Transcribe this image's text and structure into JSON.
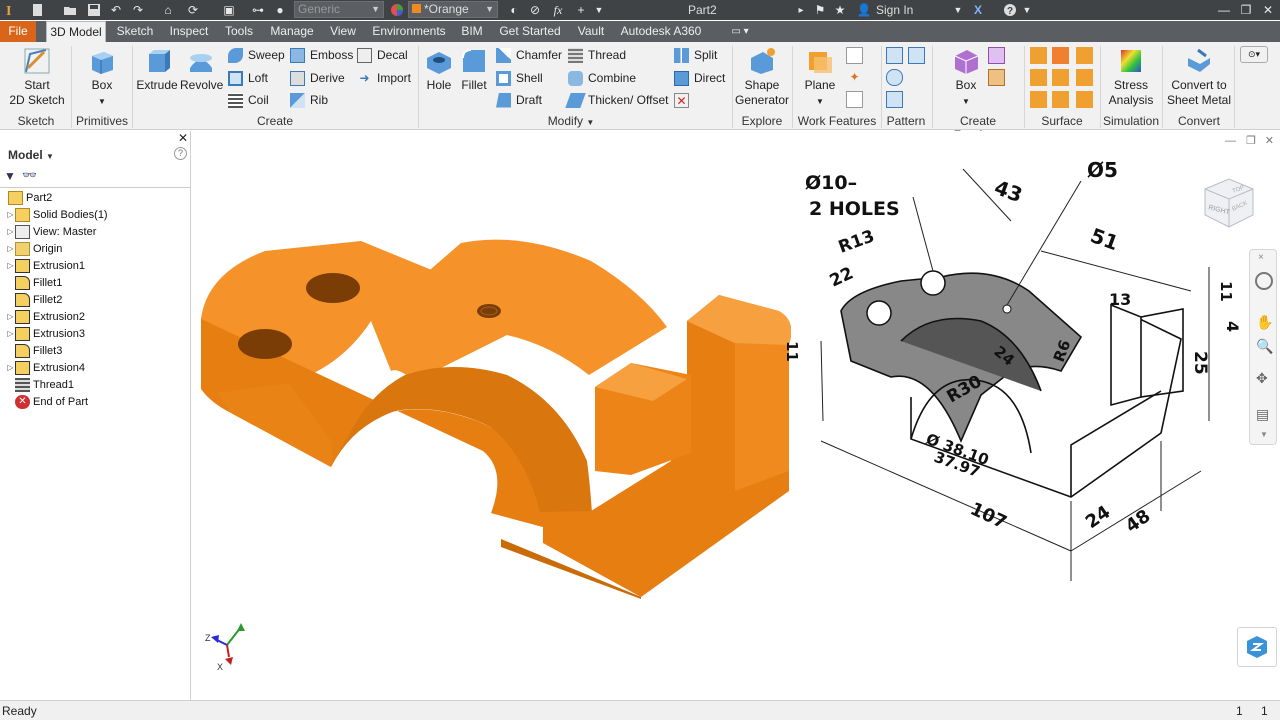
{
  "app": {
    "document_title": "Part2",
    "sign_in": "Sign In"
  },
  "quick_access": {
    "appearance_combo": "Generic",
    "material_combo": "*Orange"
  },
  "tabs": [
    "File",
    "3D Model",
    "Sketch",
    "Inspect",
    "Tools",
    "Manage",
    "View",
    "Environments",
    "BIM",
    "Get Started",
    "Vault",
    "Autodesk A360"
  ],
  "ribbon": {
    "sketch": {
      "start_line1": "Start",
      "start_line2": "2D Sketch",
      "label": "Sketch"
    },
    "primitives": {
      "box": "Box",
      "label": "Primitives"
    },
    "create": {
      "extrude": "Extrude",
      "revolve": "Revolve",
      "sweep": "Sweep",
      "loft": "Loft",
      "coil": "Coil",
      "emboss": "Emboss",
      "derive": "Derive",
      "rib": "Rib",
      "decal": "Decal",
      "import": "Import",
      "label": "Create"
    },
    "modify": {
      "hole": "Hole",
      "fillet": "Fillet",
      "chamfer": "Chamfer",
      "shell": "Shell",
      "draft": "Draft",
      "thread": "Thread",
      "combine": "Combine",
      "thicken": "Thicken/ Offset",
      "split": "Split",
      "direct": "Direct",
      "label": "Modify"
    },
    "explore": {
      "shape_line1": "Shape",
      "shape_line2": "Generator",
      "label": "Explore"
    },
    "work_features": {
      "plane": "Plane",
      "label": "Work Features"
    },
    "pattern": {
      "label": "Pattern"
    },
    "freeform": {
      "box": "Box",
      "label": "Create Freeform"
    },
    "surface": {
      "label": "Surface"
    },
    "simulation": {
      "line1": "Stress",
      "line2": "Analysis",
      "label": "Simulation"
    },
    "convert": {
      "line1": "Convert to",
      "line2": "Sheet Metal",
      "label": "Convert"
    }
  },
  "browser": {
    "title": "Model",
    "items": [
      {
        "label": "Part2"
      },
      {
        "label": "Solid Bodies(1)"
      },
      {
        "label": "View: Master"
      },
      {
        "label": "Origin"
      },
      {
        "label": "Extrusion1"
      },
      {
        "label": "Fillet1"
      },
      {
        "label": "Fillet2"
      },
      {
        "label": "Extrusion2"
      },
      {
        "label": "Extrusion3"
      },
      {
        "label": "Fillet3"
      },
      {
        "label": "Extrusion4"
      },
      {
        "label": "Thread1"
      },
      {
        "label": "End of Part"
      }
    ]
  },
  "viewcube": {
    "face_right": "RIGHT",
    "face_back": "BACK",
    "face_top": "TOP"
  },
  "triad": {
    "x": "X",
    "z": "Z"
  },
  "drawing": {
    "note1": "Ø10–",
    "note2": "2 HOLES",
    "d5": "Ø5",
    "d43": "43",
    "d51": "51",
    "r13": "R13",
    "d22": "22",
    "d13": "13",
    "d11a": "11",
    "d11b": "11",
    "d4": "4",
    "d25": "25",
    "d24a": "24",
    "r6": "R6",
    "r30": "R30",
    "dia1": "Ø 38.10",
    "dia2": "37.97",
    "d107": "107",
    "d24b": "24",
    "d48": "48"
  },
  "status": {
    "text": "Ready",
    "count1": "1",
    "count2": "1"
  },
  "colors": {
    "part_orange": "#f08a1e",
    "file_tab": "#d9651b",
    "titlebar": "#404346"
  }
}
